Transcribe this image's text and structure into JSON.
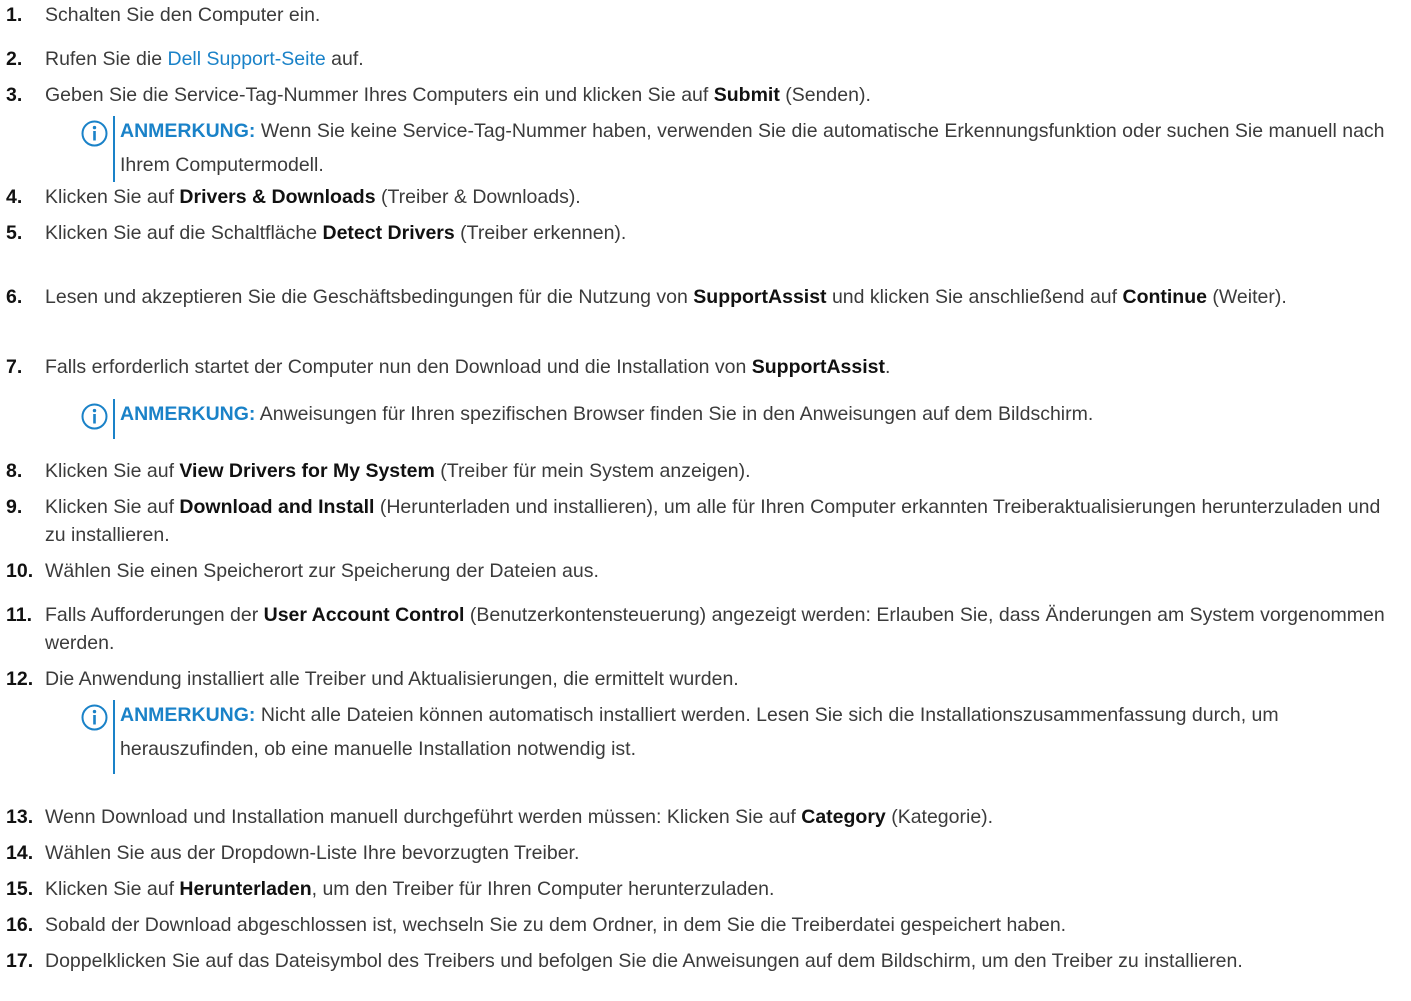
{
  "steps": [
    {
      "num": "1.",
      "parts": [
        "Schalten Sie den Computer ein."
      ]
    },
    {
      "num": "2.",
      "parts": [
        "Rufen Sie die ",
        {
          "link": "Dell Support-Seite"
        },
        " auf."
      ]
    },
    {
      "num": "3.",
      "parts": [
        "Geben Sie die Service-Tag-Nummer Ihres Computers ein und klicken Sie auf ",
        {
          "b": "Submit"
        },
        " (Senden)."
      ]
    },
    {
      "num": "4.",
      "parts": [
        "Klicken Sie auf ",
        {
          "b": "Drivers & Downloads"
        },
        " (Treiber & Downloads)."
      ]
    },
    {
      "num": "5.",
      "parts": [
        "Klicken Sie auf die Schaltfläche ",
        {
          "b": "Detect Drivers"
        },
        " (Treiber erkennen)."
      ]
    },
    {
      "num": "6.",
      "parts": [
        "Lesen und akzeptieren Sie die Geschäftsbedingungen für die Nutzung von ",
        {
          "b": "SupportAssist"
        },
        " und klicken Sie anschließend auf ",
        {
          "b": "Continue"
        },
        " (Weiter)."
      ]
    },
    {
      "num": "7.",
      "parts": [
        "Falls erforderlich startet der Computer nun den Download und die Installation von ",
        {
          "b": "SupportAssist"
        },
        "."
      ]
    },
    {
      "num": "8.",
      "parts": [
        "Klicken Sie auf ",
        {
          "b": "View Drivers for My System"
        },
        " (Treiber für mein System anzeigen)."
      ]
    },
    {
      "num": "9.",
      "parts": [
        "Klicken Sie auf ",
        {
          "b": "Download and Install"
        },
        " (Herunterladen und installieren), um alle für Ihren Computer erkannten Treiberaktualisierungen herunterzuladen und zu installieren."
      ]
    },
    {
      "num": "10.",
      "parts": [
        "Wählen Sie einen Speicherort zur Speicherung der Dateien aus."
      ]
    },
    {
      "num": "11.",
      "parts": [
        "Falls Aufforderungen der ",
        {
          "b": "User Account Control"
        },
        " (Benutzerkontensteuerung) angezeigt werden: Erlauben Sie, dass Änderungen am System vorgenommen werden."
      ]
    },
    {
      "num": "12.",
      "parts": [
        "Die Anwendung installiert alle Treiber und Aktualisierungen, die ermittelt wurden."
      ]
    },
    {
      "num": "13.",
      "parts": [
        "Wenn Download und Installation manuell durchgeführt werden müssen: Klicken Sie auf ",
        {
          "b": "Category"
        },
        " (Kategorie)."
      ]
    },
    {
      "num": "14.",
      "parts": [
        "Wählen Sie aus der Dropdown-Liste Ihre bevorzugten Treiber."
      ]
    },
    {
      "num": "15.",
      "parts": [
        "Klicken Sie auf ",
        {
          "b": "Herunterladen"
        },
        ", um den Treiber für Ihren Computer herunterzuladen."
      ]
    },
    {
      "num": "16.",
      "parts": [
        "Sobald der Download abgeschlossen ist, wechseln Sie zu dem Ordner, in dem Sie die Treiberdatei gespeichert haben."
      ]
    },
    {
      "num": "17.",
      "parts": [
        "Doppelklicken Sie auf das Dateisymbol des Treibers und befolgen Sie die Anweisungen auf dem Bildschirm, um den Treiber zu installieren."
      ]
    }
  ],
  "notes": [
    {
      "label": "ANMERKUNG:",
      "text": " Wenn Sie keine Service-Tag-Nummer haben, verwenden Sie die automatische Erkennungsfunktion oder suchen Sie manuell nach Ihrem Computermodell."
    },
    {
      "label": "ANMERKUNG:",
      "text": " Anweisungen für Ihren spezifischen Browser finden Sie in den Anweisungen auf dem Bildschirm."
    },
    {
      "label": "ANMERKUNG:",
      "text": " Nicht alle Dateien können automatisch installiert werden. Lesen Sie sich die Installationszusammenfassung durch, um herauszufinden, ob eine manuelle Installation notwendig ist."
    }
  ],
  "colors": {
    "link": "#1a82c8",
    "note_accent": "#1a82c8",
    "text": "#3b3b3b",
    "bold": "#111111"
  },
  "icons": {
    "note": "info-icon"
  }
}
